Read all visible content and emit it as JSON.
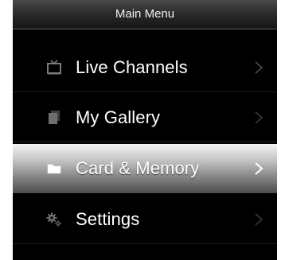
{
  "header": {
    "title": "Main Menu"
  },
  "menu": {
    "items": [
      {
        "label": "Live Channels",
        "icon": "tv-icon",
        "selected": false
      },
      {
        "label": "My Gallery",
        "icon": "gallery-icon",
        "selected": false
      },
      {
        "label": "Card & Memory",
        "icon": "folder-icon",
        "selected": true
      },
      {
        "label": "Settings",
        "icon": "gears-icon",
        "selected": false
      }
    ]
  },
  "colors": {
    "background": "#000000",
    "text": "#ffffff",
    "icon_dim": "#777777",
    "chevron_dim": "#555555",
    "selected_highlight": "#c9c9c9"
  }
}
